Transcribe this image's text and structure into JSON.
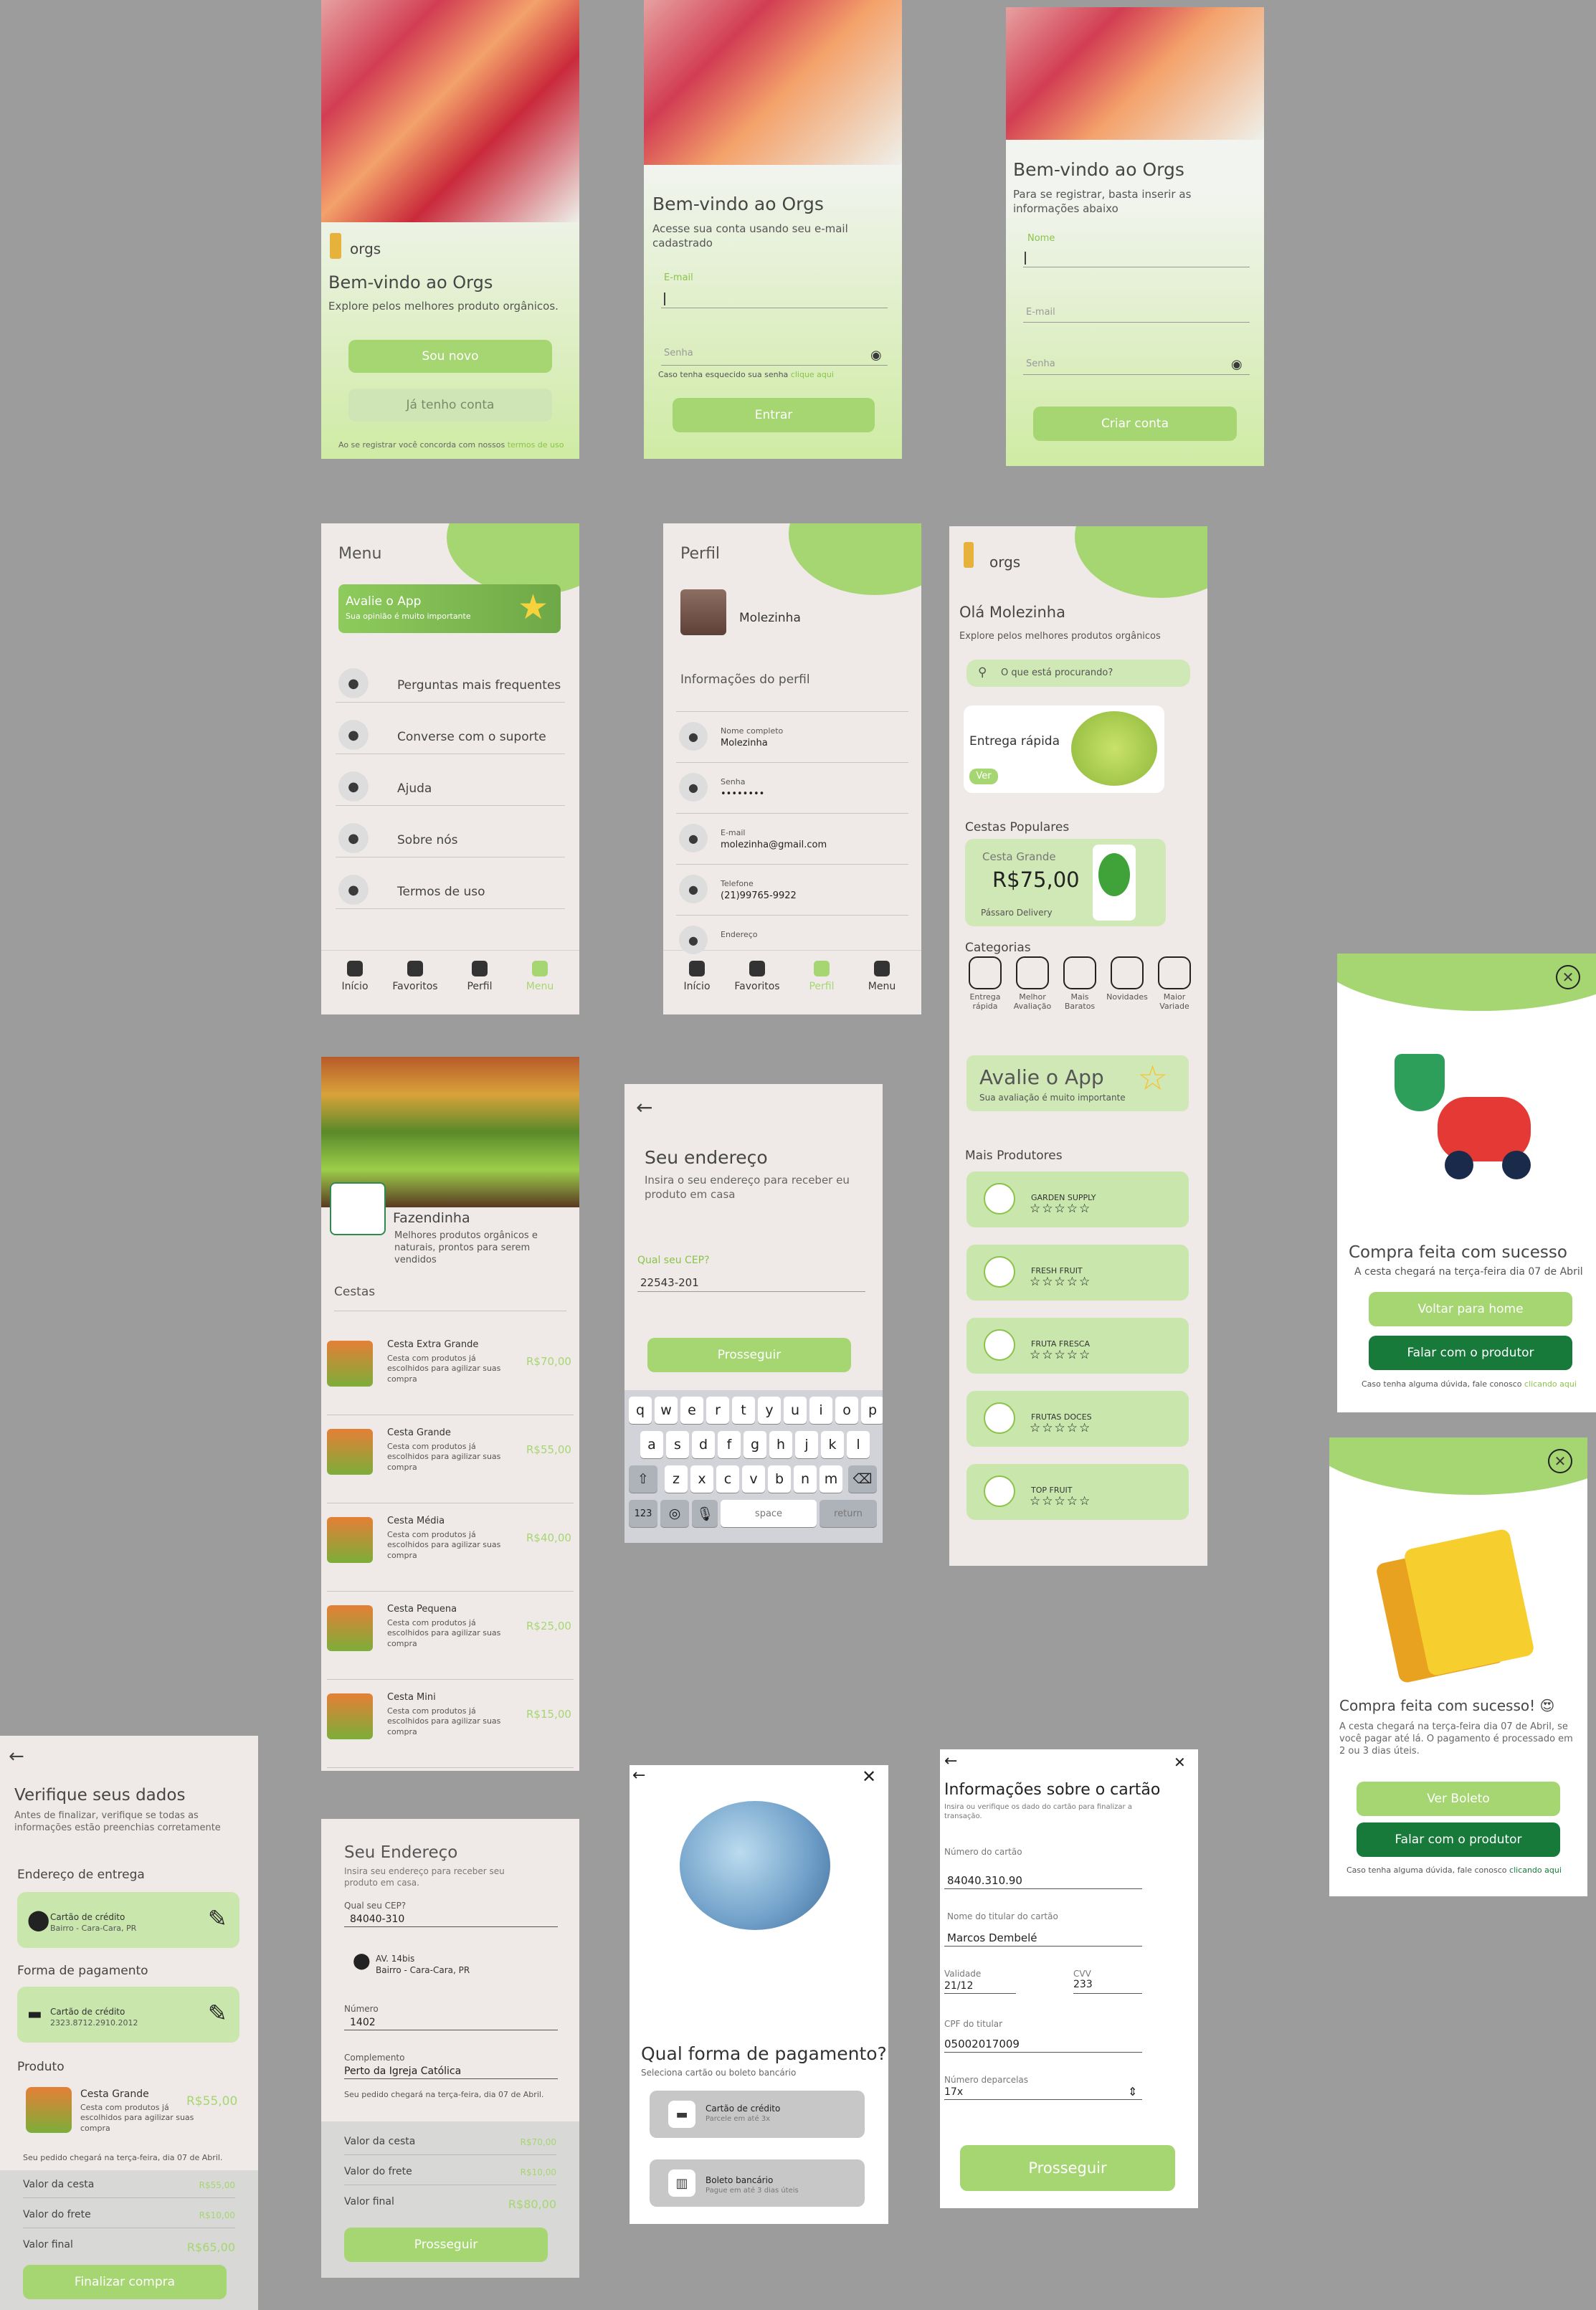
{
  "welcome": {
    "logo": "orgs",
    "title": "Bem-vindo ao Orgs",
    "subtitle": "Explore pelos melhores produto orgânicos.",
    "btn_new": "Sou novo",
    "btn_account": "Já tenho conta",
    "terms_prefix": "Ao se registrar você concorda com nossos",
    "terms_link": "termos de uso"
  },
  "login": {
    "title": "Bem-vindo ao Orgs",
    "subtitle": "Acesse sua conta usando seu e-mail cadastrado",
    "email_label": "E-mail",
    "password_label": "Senha",
    "forgot_text": "Caso tenha esquecido sua senha",
    "forgot_link": "clique aqui",
    "btn": "Entrar"
  },
  "register": {
    "title": "Bem-vindo ao Orgs",
    "subtitle": "Para se registrar, basta inserir as informações abaixo",
    "name_label": "Nome",
    "email_label": "E-mail",
    "password_label": "Senha",
    "btn": "Criar conta"
  },
  "menu": {
    "title": "Menu",
    "rate_title": "Avalie o App",
    "rate_sub": "Sua opinião é muito importante",
    "items": [
      "Perguntas mais frequentes",
      "Converse com o suporte",
      "Ajuda",
      "Sobre nós",
      "Termos de uso"
    ]
  },
  "profile": {
    "title": "Perfil",
    "name": "Molezinha",
    "section": "Informações do perfil",
    "fields": [
      {
        "label": "Nome completo",
        "value": "Molezinha"
      },
      {
        "label": "Senha",
        "value": "••••••••"
      },
      {
        "label": "E-mail",
        "value": "molezinha@gmail.com"
      },
      {
        "label": "Telefone",
        "value": "(21)99765-9922"
      },
      {
        "label": "Endereço",
        "value": ""
      }
    ]
  },
  "nav": {
    "home": "Início",
    "fav": "Favoritos",
    "profile": "Perfil",
    "menu": "Menu"
  },
  "home": {
    "logo": "orgs",
    "greeting": "Olá Molezinha",
    "sub": "Explore pelos melhores produtos orgânicos",
    "search_placeholder": "O que está procurando?",
    "fast_title": "Entrega rápida",
    "fast_btn": "Ver",
    "popular_title": "Cestas Populares",
    "basket_name": "Cesta Grande",
    "basket_price": "R$75,00",
    "basket_vendor": "Pássaro Delivery",
    "categories_title": "Categorias",
    "categories": [
      {
        "l1": "Entrega",
        "l2": "rápida"
      },
      {
        "l1": "Melhor",
        "l2": "Avaliação"
      },
      {
        "l1": "Mais",
        "l2": "Baratos"
      },
      {
        "l1": "Novidades",
        "l2": ""
      },
      {
        "l1": "Maior",
        "l2": "Variade"
      }
    ],
    "rate_title": "Avalie o App",
    "rate_sub": "Sua avaliação é muito importante",
    "producers_title": "Mais Produtores",
    "producers": [
      "GARDEN SUPPLY",
      "FRESH FRUIT",
      "FRUTA FRESCA",
      "FRUTAS DOCES",
      "TOP FRUIT"
    ],
    "stars": "☆☆☆☆☆"
  },
  "success1": {
    "title": "Compra feita com sucesso",
    "sub": "A cesta chegará na terça-feira dia 07 de Abril",
    "btn1": "Voltar para home",
    "btn2": "Falar com o produtor",
    "help_prefix": "Caso tenha alguma dúvida, fale conosco",
    "help_link": "clicando aqui"
  },
  "farm": {
    "name": "Fazendinha",
    "desc": "Melhores produtos orgânicos e naturais, prontos para serem vendidos",
    "section": "Cestas",
    "baskets": [
      {
        "name": "Cesta Extra Grande",
        "price": "R$70,00"
      },
      {
        "name": "Cesta Grande",
        "price": "R$55,00"
      },
      {
        "name": "Cesta Média",
        "price": "R$40,00"
      },
      {
        "name": "Cesta Pequena",
        "price": "R$25,00"
      },
      {
        "name": "Cesta Mini",
        "price": "R$15,00"
      }
    ],
    "basket_desc": "Cesta com produtos já escolhidos para agilizar suas compra"
  },
  "address1": {
    "title": "Seu endereço",
    "sub": "Insira o seu endereço para receber eu produto em casa",
    "cep_label": "Qual seu CEP?",
    "cep": "22543-201",
    "btn": "Prosseguir",
    "keys_r1": [
      "q",
      "w",
      "e",
      "r",
      "t",
      "y",
      "u",
      "i",
      "o",
      "p"
    ],
    "keys_r2": [
      "a",
      "s",
      "d",
      "f",
      "g",
      "h",
      "j",
      "k",
      "l"
    ],
    "keys_r3": [
      "z",
      "x",
      "c",
      "v",
      "b",
      "n",
      "m"
    ],
    "key_123": "123",
    "key_space": "space",
    "key_return": "return"
  },
  "success2": {
    "title": "Compra feita com sucesso! 😍",
    "sub": "A cesta chegará na terça-feira dia 07 de Abril, se você pagar até lá. O pagamento é processado em 2 ou 3 dias úteis.",
    "btn1": "Ver Boleto",
    "btn2": "Falar com o produtor",
    "help_prefix": "Caso tenha alguma dúvida, fale conosco",
    "help_link": "clicando aqui"
  },
  "verify": {
    "title": "Verifique seus dados",
    "sub": "Antes de finalizar, verifique se todas as informações estão preenchias corretamente",
    "addr_title": "Endereço de entrega",
    "addr_line1": "Cartão de crédito",
    "addr_line2": "Bairro - Cara-Cara, PR",
    "pay_title": "Forma de pagamento",
    "pay_line1": "Cartão de crédito",
    "pay_line2": "2323.8712.2910.2012",
    "prod_title": "Produto",
    "prod_name": "Cesta Grande",
    "prod_desc": "Cesta com produtos já escolhidos para agilizar suas compra",
    "prod_price": "R$55,00",
    "delivery": "Seu pedido chegará na terça-feira, dia 07 de Abril.",
    "totals": [
      {
        "label": "Valor da cesta",
        "value": "R$55,00"
      },
      {
        "label": "Valor do frete",
        "value": "R$10,00"
      },
      {
        "label": "Valor  final",
        "value": "R$65,00"
      }
    ],
    "btn": "Finalizar compra"
  },
  "address2": {
    "title": "Seu Endereço",
    "sub": "Insira seu endereço para receber seu produto em casa.",
    "cep_label": "Qual seu CEP?",
    "cep": "84040-310",
    "addr1": "AV. 14bis",
    "addr2": "Bairro - Cara-Cara, PR",
    "num_label": "Número",
    "num": "1402",
    "comp_label": "Complemento",
    "comp": "Perto da Igreja Católica",
    "delivery": "Seu pedido chegará na terça-feira, dia 07 de Abril.",
    "totals": [
      {
        "label": "Valor da cesta",
        "value": "R$70,00"
      },
      {
        "label": "Valor do frete",
        "value": "R$10,00"
      },
      {
        "label": "Valor  final",
        "value": "R$80,00"
      }
    ],
    "btn": "Prosseguir"
  },
  "payment": {
    "title": "Qual forma de pagamento?",
    "sub": "Seleciona cartão ou boleto bancário",
    "opt1": "Cartão de crédito",
    "opt1_sub": "Parcele em até 3x",
    "opt2": "Boleto bancário",
    "opt2_sub": "Pague em até 3 dias úteis"
  },
  "card": {
    "title": "Informações sobre o cartão",
    "sub": "Insira ou verifique os dado do cartão para finalizar a transação.",
    "num_label": "Número do cartão",
    "num": "84040.310.90",
    "holder_label": "Nome do titular do cartão",
    "holder": "Marcos Dembelé",
    "valid_label": "Validade",
    "valid": "21/12",
    "cvv_label": "CVV",
    "cvv": "233",
    "cpf_label": "CPF do titular",
    "cpf": "05002017009",
    "inst_label": "Número deparcelas",
    "inst": "17x",
    "btn": "Prosseguir"
  },
  "colors": {
    "bg": "#9c9c9c",
    "accent": "#a6d672",
    "dark": "#177a3a",
    "screen": "#efeae8"
  }
}
